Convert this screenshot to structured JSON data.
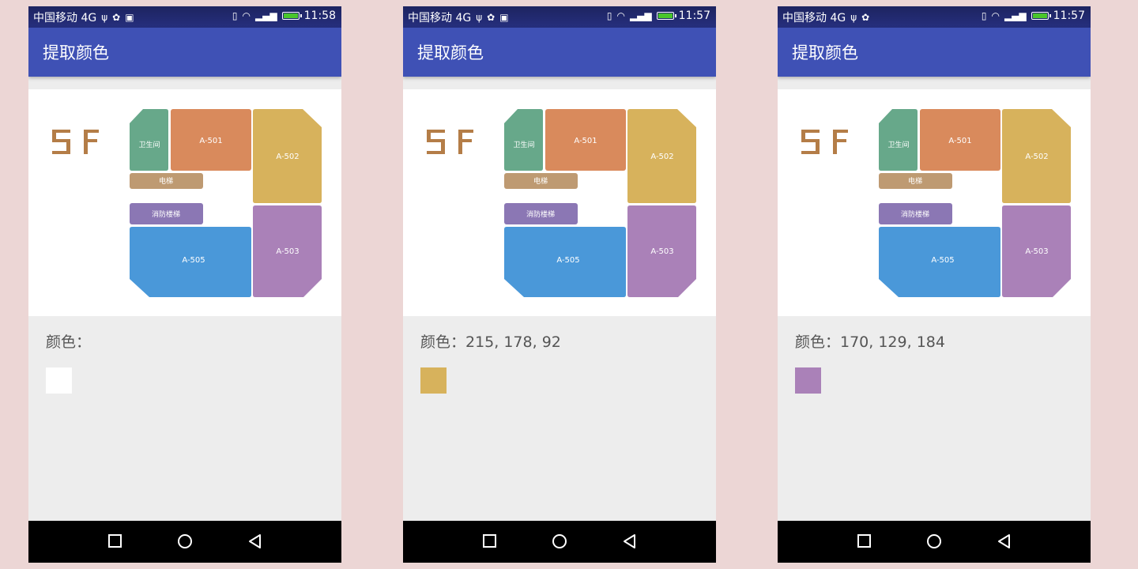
{
  "colors": {
    "page_bg": "#ecd6d5",
    "appbar": "#3f51b5",
    "statusbar": "#262f7e",
    "washroom": "#67a88a",
    "a501": "#d98a5c",
    "a502": "#d7b25c",
    "elevator": "#be9a72",
    "stairs": "#8b77b4",
    "a505": "#4a98d9",
    "a503": "#aa81b8",
    "logo": "#b47d47"
  },
  "map": {
    "floor_label": "5F",
    "rooms": {
      "washroom": "卫生间",
      "a501": "A-501",
      "a502": "A-502",
      "elevator": "电梯",
      "stairs": "消防楼梯",
      "a505": "A-505",
      "a503": "A-503"
    }
  },
  "phones": [
    {
      "status": {
        "carrier": "中国移动 4G",
        "time": "11:58",
        "icons": [
          "usb-icon",
          "android-debug-icon",
          "image-icon"
        ]
      },
      "appbar_title": "提取颜色",
      "color_text": "颜色：",
      "swatch_color": "#ffffff"
    },
    {
      "status": {
        "carrier": "中国移动 4G",
        "time": "11:57",
        "icons": [
          "usb-icon",
          "android-debug-icon",
          "image-icon"
        ]
      },
      "appbar_title": "提取颜色",
      "color_text": "颜色：215, 178, 92",
      "swatch_color": "#d7b25c"
    },
    {
      "status": {
        "carrier": "中国移动 4G",
        "time": "11:57",
        "icons": [
          "usb-icon",
          "android-debug-icon"
        ]
      },
      "appbar_title": "提取颜色",
      "color_text": "颜色：170, 129, 184",
      "swatch_color": "#aa81b8"
    }
  ]
}
